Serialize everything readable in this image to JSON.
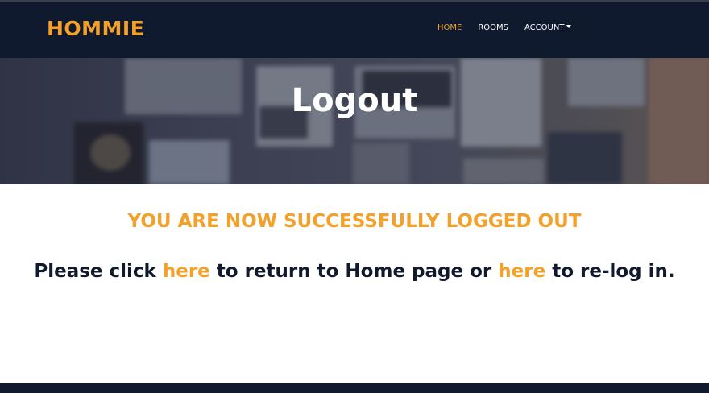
{
  "navbar": {
    "brand": "HOMMIE",
    "items": [
      {
        "label": "HOME",
        "active": true
      },
      {
        "label": "ROOMS",
        "active": false
      },
      {
        "label": "ACCOUNT",
        "active": false,
        "dropdown": true
      }
    ]
  },
  "hero": {
    "title": "Logout"
  },
  "main": {
    "success_message": "YOU ARE NOW SUCCESSFULLY LOGGED OUT",
    "instruction": {
      "part1": "Please click ",
      "link1": "here",
      "part2": " to return to Home page or ",
      "link2": "here",
      "part3": " to re-log in."
    }
  },
  "colors": {
    "accent": "#f4a12c",
    "navbar_bg": "#101a2e",
    "text_dark": "#111a2c"
  }
}
